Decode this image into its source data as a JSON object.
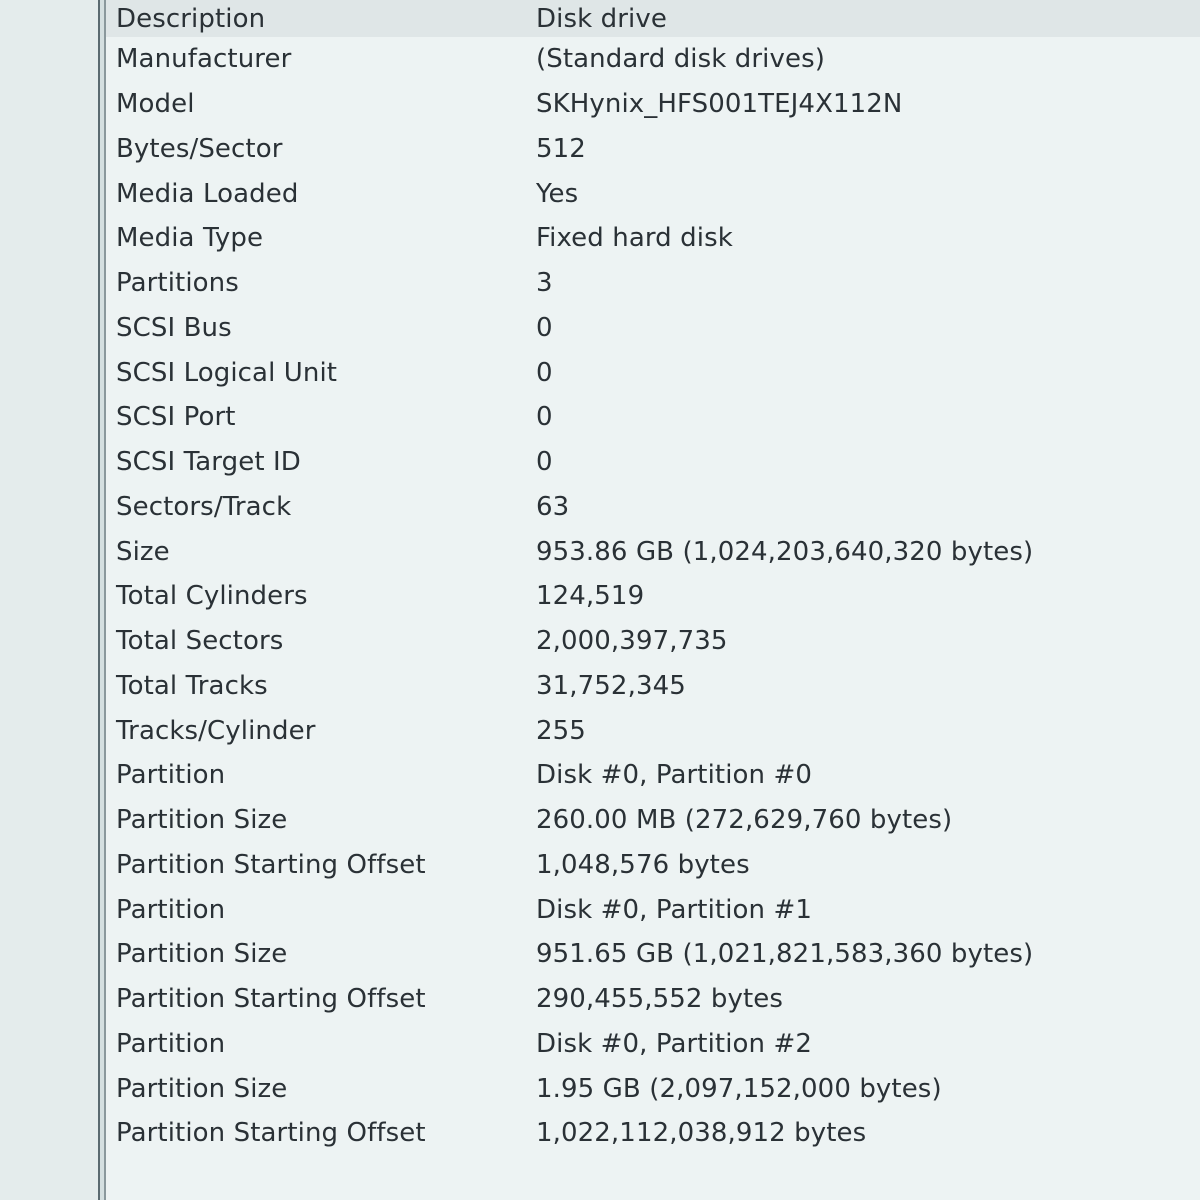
{
  "properties": [
    {
      "name": "Description",
      "value": "Disk drive"
    },
    {
      "name": "Manufacturer",
      "value": "(Standard disk drives)"
    },
    {
      "name": "Model",
      "value": "SKHynix_HFS001TEJ4X112N"
    },
    {
      "name": "Bytes/Sector",
      "value": "512"
    },
    {
      "name": "Media Loaded",
      "value": "Yes"
    },
    {
      "name": "Media Type",
      "value": "Fixed hard disk"
    },
    {
      "name": "Partitions",
      "value": "3"
    },
    {
      "name": "SCSI Bus",
      "value": "0"
    },
    {
      "name": "SCSI Logical Unit",
      "value": "0"
    },
    {
      "name": "SCSI Port",
      "value": "0"
    },
    {
      "name": "SCSI Target ID",
      "value": "0"
    },
    {
      "name": "Sectors/Track",
      "value": "63"
    },
    {
      "name": "Size",
      "value": "953.86 GB (1,024,203,640,320 bytes)"
    },
    {
      "name": "Total Cylinders",
      "value": "124,519"
    },
    {
      "name": "Total Sectors",
      "value": "2,000,397,735"
    },
    {
      "name": "Total Tracks",
      "value": "31,752,345"
    },
    {
      "name": "Tracks/Cylinder",
      "value": "255"
    },
    {
      "name": "Partition",
      "value": "Disk #0, Partition #0"
    },
    {
      "name": "Partition Size",
      "value": "260.00 MB (272,629,760 bytes)"
    },
    {
      "name": "Partition Starting Offset",
      "value": "1,048,576 bytes"
    },
    {
      "name": "Partition",
      "value": "Disk #0, Partition #1"
    },
    {
      "name": "Partition Size",
      "value": "951.65 GB (1,021,821,583,360 bytes)"
    },
    {
      "name": "Partition Starting Offset",
      "value": "290,455,552 bytes"
    },
    {
      "name": "Partition",
      "value": "Disk #0, Partition #2"
    },
    {
      "name": "Partition Size",
      "value": "1.95 GB (2,097,152,000 bytes)"
    },
    {
      "name": "Partition Starting Offset",
      "value": "1,022,112,038,912 bytes"
    }
  ]
}
